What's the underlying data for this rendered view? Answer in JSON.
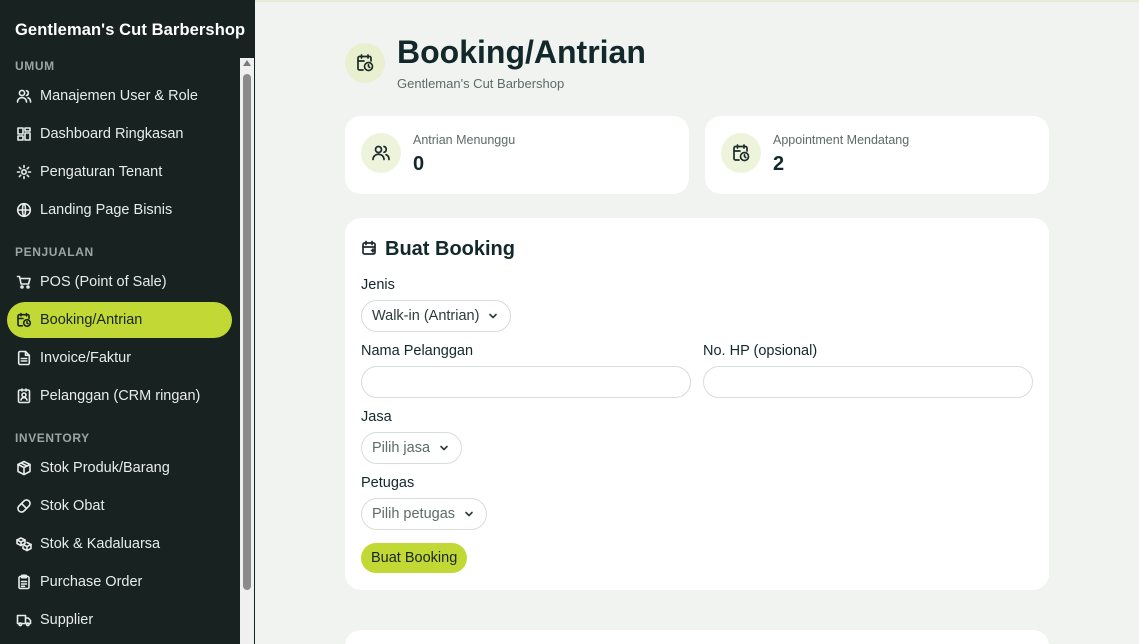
{
  "app": {
    "title": "Gentleman's Cut Barbershop"
  },
  "sidebar": {
    "sections": [
      {
        "label": "UMUM"
      },
      {
        "label": "PENJUALAN"
      },
      {
        "label": "INVENTORY"
      }
    ],
    "items": [
      {
        "label": "Manajemen User & Role",
        "icon": "users-icon"
      },
      {
        "label": "Dashboard Ringkasan",
        "icon": "dashboard-icon"
      },
      {
        "label": "Pengaturan Tenant",
        "icon": "gear-icon"
      },
      {
        "label": "Landing Page Bisnis",
        "icon": "globe-icon"
      },
      {
        "label": "POS (Point of Sale)",
        "icon": "cart-icon"
      },
      {
        "label": "Booking/Antrian",
        "icon": "calendar-clock-icon",
        "active": true
      },
      {
        "label": "Invoice/Faktur",
        "icon": "document-icon"
      },
      {
        "label": "Pelanggan (CRM ringan)",
        "icon": "contact-icon"
      },
      {
        "label": "Stok Produk/Barang",
        "icon": "box-icon"
      },
      {
        "label": "Stok Obat",
        "icon": "pill-icon"
      },
      {
        "label": "Stok & Kadaluarsa",
        "icon": "boxes-icon"
      },
      {
        "label": "Purchase Order",
        "icon": "clipboard-icon"
      },
      {
        "label": "Supplier",
        "icon": "truck-icon"
      }
    ]
  },
  "header": {
    "title": "Booking/Antrian",
    "subtitle": "Gentleman's Cut Barbershop",
    "icon": "calendar-clock-icon"
  },
  "stats": [
    {
      "label": "Antrian Menunggu",
      "value": "0",
      "icon": "users-icon"
    },
    {
      "label": "Appointment Mendatang",
      "value": "2",
      "icon": "calendar-clock-icon"
    }
  ],
  "form": {
    "title": "Buat Booking",
    "jenis_label": "Jenis",
    "jenis_value": "Walk-in (Antrian)",
    "nama_label": "Nama Pelanggan",
    "nama_value": "",
    "hp_label": "No. HP (opsional)",
    "hp_value": "",
    "jasa_label": "Jasa",
    "jasa_value": "Pilih jasa",
    "petugas_label": "Petugas",
    "petugas_value": "Pilih petugas",
    "submit_label": "Buat Booking"
  },
  "colors": {
    "sidebar_bg": "#182321",
    "accent": "#c2d935",
    "page_bg": "#f1f3f1",
    "card_bg": "#ffffff"
  }
}
